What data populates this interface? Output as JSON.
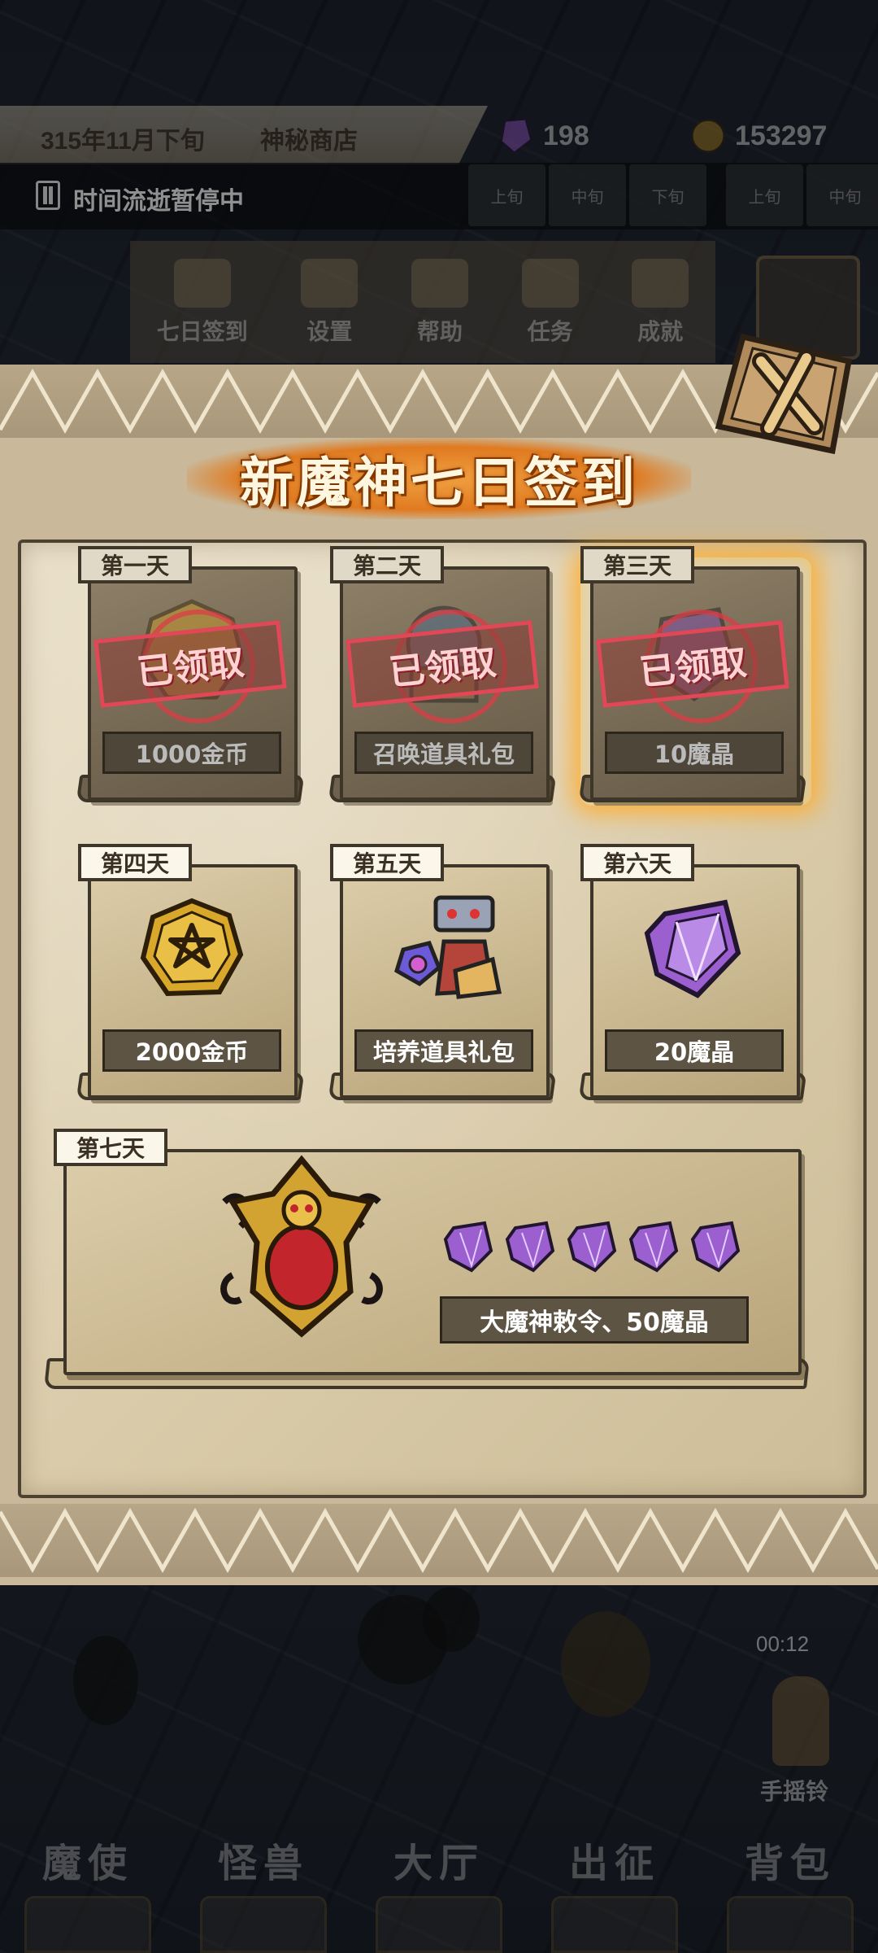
{
  "header": {
    "date": "315年11月下旬",
    "location": "神秘商店",
    "crystals": "198",
    "gold": "153297",
    "time_status": "时间流逝暂停中",
    "slots": [
      "上旬",
      "中旬",
      "下旬",
      "上旬",
      "中旬"
    ]
  },
  "menu": {
    "items": [
      {
        "label": "七日签到",
        "icon": "seven-day-icon"
      },
      {
        "label": "设置",
        "icon": "gear-icon"
      },
      {
        "label": "帮助",
        "icon": "help-icon"
      },
      {
        "label": "任务",
        "icon": "quest-icon"
      },
      {
        "label": "成就",
        "icon": "trophy-icon"
      }
    ]
  },
  "modal": {
    "title": "新魔神七日签到",
    "claimed_label": "已领取",
    "days": [
      {
        "day": "第一天",
        "reward": "1000金币",
        "status": "claimed",
        "icon": "gold-coin-icon"
      },
      {
        "day": "第二天",
        "reward": "召唤道具礼包",
        "status": "claimed",
        "icon": "summon-pack-icon"
      },
      {
        "day": "第三天",
        "reward": "10魔晶",
        "status": "claimed",
        "icon": "crystal-icon"
      },
      {
        "day": "第四天",
        "reward": "2000金币",
        "status": "locked",
        "icon": "gold-coin-icon"
      },
      {
        "day": "第五天",
        "reward": "培养道具礼包",
        "status": "locked",
        "icon": "training-pack-icon"
      },
      {
        "day": "第六天",
        "reward": "20魔晶",
        "status": "locked",
        "icon": "crystal-icon"
      }
    ],
    "final_day": {
      "day": "第七天",
      "reward": "大魔神敕令、50魔晶",
      "icon": "demon-edict-icon"
    }
  },
  "scene": {
    "timer": "00:12",
    "bell_label": "手摇铃"
  },
  "bottom_nav": [
    "魔使",
    "怪兽",
    "大厅",
    "出征",
    "背包"
  ],
  "colors": {
    "accent_orange": "#e07a20",
    "stamp_red": "#e04858",
    "crystal_purple": "#9b5fd0",
    "gold": "#d9a72a"
  }
}
